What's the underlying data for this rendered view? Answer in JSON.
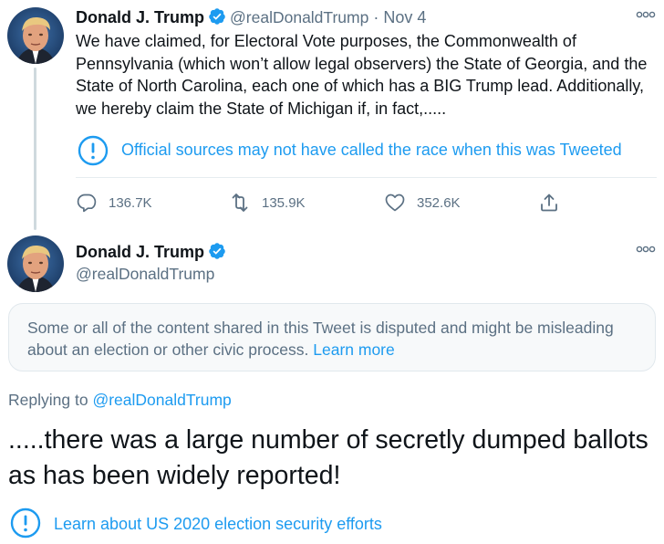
{
  "tweet1": {
    "name": "Donald J. Trump",
    "handle": "@realDonaldTrump",
    "separator": "·",
    "date": "Nov 4",
    "text": "We have claimed, for Electoral Vote purposes, the Commonwealth of Pennsylvania (which won’t allow legal observers) the State of Georgia, and the State of North Carolina, each one of which has a BIG Trump lead. Additionally, we hereby claim the State of Michigan if, in fact,.....",
    "notice": "Official sources may not have called the race when this was Tweeted",
    "stats": {
      "replies": "136.7K",
      "retweets": "135.9K",
      "likes": "352.6K"
    }
  },
  "tweet2": {
    "name": "Donald J. Trump",
    "handle": "@realDonaldTrump",
    "disputed_text": "Some or all of the content shared in this Tweet is disputed and might be misleading about an election or other civic process.",
    "disputed_link": "Learn more",
    "replying_prefix": "Replying to",
    "replying_handle": "@realDonaldTrump",
    "text": ".....there was a large number of secretly dumped ballots as has been widely reported!",
    "election_link": "Learn about US 2020 election security efforts"
  },
  "colors": {
    "link": "#1d9bf0",
    "muted": "#5b7083",
    "verified": "#1d9bf0"
  },
  "icons": {
    "more": "more-icon",
    "verified": "verified-badge-icon",
    "notice": "exclamation-circle-icon",
    "reply": "reply-icon",
    "retweet": "retweet-icon",
    "like": "heart-icon",
    "share": "share-icon"
  }
}
